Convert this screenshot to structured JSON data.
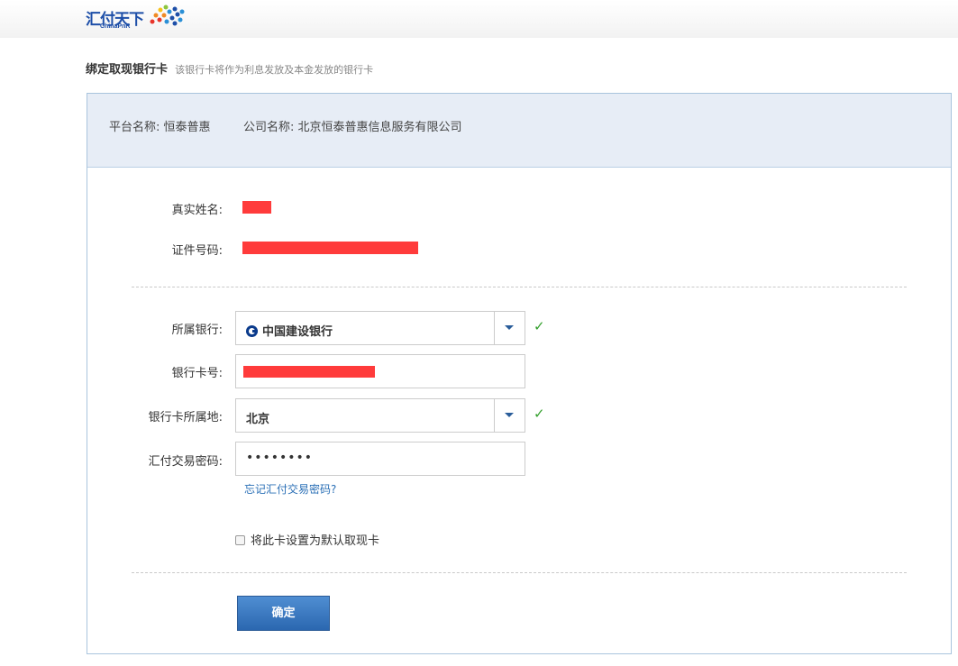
{
  "logo": {
    "name_cn": "汇付天下",
    "name_en": "ChinaPnR"
  },
  "heading": {
    "title": "绑定取现银行卡",
    "subtitle": "该银行卡将作为利息发放及本金发放的银行卡"
  },
  "info": {
    "platform_label": "平台名称:",
    "platform_value": "恒泰普惠",
    "company_label": "公司名称:",
    "company_value": "北京恒泰普惠信息服务有限公司"
  },
  "identity": {
    "real_name_label": "真实姓名:",
    "id_number_label": "证件号码:"
  },
  "form": {
    "bank_label": "所属银行:",
    "bank_value": "中国建设银行",
    "card_number_label": "银行卡号:",
    "card_location_label": "银行卡所属地:",
    "card_location_value": "北京",
    "password_label": "汇付交易密码:",
    "password_value": "••••••••",
    "forgot_password": "忘记汇付交易密码?",
    "default_card_label": "将此卡设置为默认取现卡",
    "default_card_checked": false,
    "submit_label": "确定",
    "valid_mark": "✓"
  },
  "colors": {
    "accent": "#2b67b0",
    "redaction": "#ff3b3b",
    "valid": "#33a02c",
    "info_bg": "#e7edf6"
  },
  "icons": {
    "bank": "ccb-bank-icon",
    "dropdown": "chevron-down-icon",
    "valid": "checkmark-icon"
  }
}
